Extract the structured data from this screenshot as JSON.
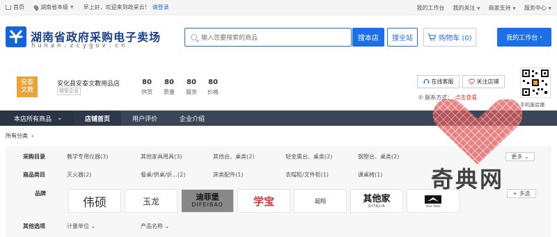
{
  "topbar": {
    "home": "首页",
    "region": "湖南省本级",
    "greeting": "早上好，欢迎来到政采云！",
    "login": "请登录",
    "right_links": [
      "我的工作台",
      "我的关注",
      "商家支持",
      "服务中心"
    ]
  },
  "header": {
    "title": "湖南省政府采购电子卖场",
    "domain": "hunan.zcygov.cn",
    "search_placeholder": "输入您要搜索的商品",
    "search_store": "搜本店",
    "search_all": "搜全站",
    "cart": "购物车 (0)",
    "workbench": "我的工作台"
  },
  "shop": {
    "logo_line1": "安泰",
    "logo_line2": "文教",
    "name": "安化县安泰文教用品店",
    "tag": "微型企业",
    "scores": [
      {
        "value": "80",
        "label": "供货"
      },
      {
        "value": "80",
        "label": "质量"
      },
      {
        "value": "80",
        "label": "服务"
      },
      {
        "value": "80",
        "label": "价格"
      }
    ],
    "service": "在线客服",
    "follow": "关注店铺",
    "contact": "联系方式：",
    "contact_link": "点击查看",
    "qr_caption": "手机版店铺"
  },
  "nav": {
    "all": "本店所有商品",
    "items": [
      "店铺首页",
      "用户评价",
      "企业介绍"
    ]
  },
  "filters": {
    "crumb": "所有分类",
    "rows": [
      {
        "label": "采购目录",
        "cells": [
          "教学专用仪器(3)",
          "其他家具用具(3)",
          "其他台、桌类(2)",
          "轻金属台、桌类(2)",
          "钢塑台、桌类(2)"
        ]
      },
      {
        "label": "商品类目",
        "cells": [
          "灭火器(2)",
          "餐桌/供桌/折...(2)",
          "床类配件(1)",
          "衣帽柜/文件柜(1)",
          "课桌椅(1)"
        ]
      },
      {
        "label": "品牌",
        "cells": []
      },
      {
        "label": "其他选项",
        "cells": [
          "计量单位",
          "产品名称"
        ]
      }
    ],
    "more": "更多",
    "multi": "+ 多选",
    "brands": [
      "伟硕",
      "玉龙",
      "迪菲堡",
      "学宝",
      "超翔",
      "其他家",
      "Yuan Yanzi"
    ],
    "brand_sub": {
      "dfb": "DIFEIBAO",
      "qtj": "QITAJIA"
    }
  },
  "watermark": "奇典网",
  "colors": {
    "accent": "#1d6fe5",
    "nav_bg": "#3a4557",
    "logo_bg": "#e8a53a"
  }
}
